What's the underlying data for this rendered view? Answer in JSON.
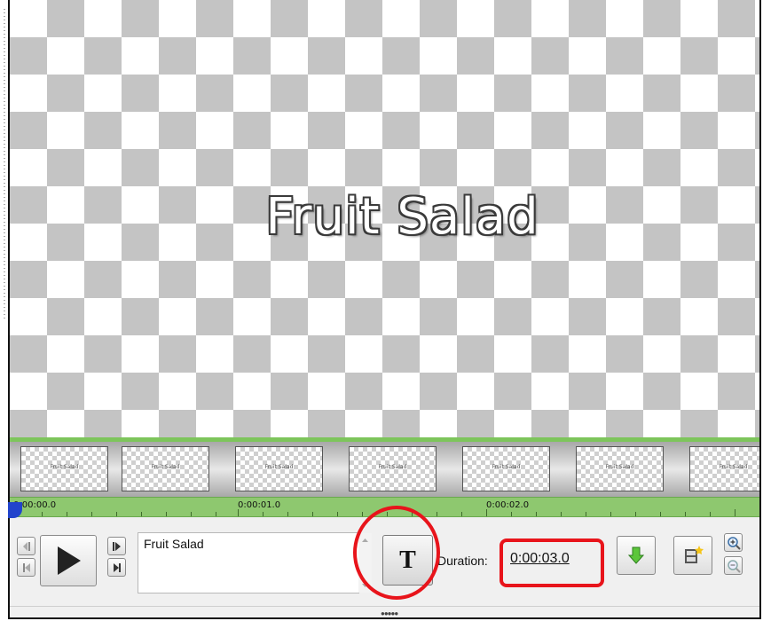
{
  "preview": {
    "title_text": "Fruit Salad"
  },
  "filmstrip": {
    "thumb_label": "Fruit Salad",
    "frame_count": 7
  },
  "timeline": {
    "labels": [
      "0:00:00.0",
      "0:00:01.0",
      "0:00:02.0"
    ]
  },
  "editor": {
    "text_value": "Fruit Salad",
    "text_style_button": "T",
    "duration_label": "Duration:",
    "duration_value": "0:00:03.0"
  },
  "icons": {
    "prev_frame": "step-back-icon",
    "next_frame": "step-forward-icon",
    "go_start": "go-to-start-icon",
    "go_end": "go-to-end-icon",
    "play": "play-icon",
    "apply_down": "green-down-arrow-icon",
    "new_title": "film-star-icon",
    "zoom_in": "zoom-in-icon",
    "zoom_out": "zoom-out-icon"
  },
  "colors": {
    "highlight": "#e8141b",
    "timeline_green": "#8ec86f",
    "playhead": "#2244cc"
  }
}
